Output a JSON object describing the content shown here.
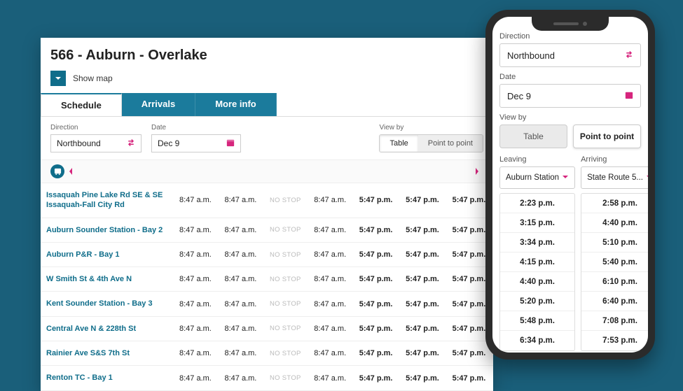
{
  "route": {
    "title": "566 - Auburn - Overlake"
  },
  "showmap": {
    "label": "Show map"
  },
  "tabs": [
    {
      "label": "Schedule",
      "active": true
    },
    {
      "label": "Arrivals",
      "active": false
    },
    {
      "label": "More info",
      "active": false
    }
  ],
  "controls": {
    "direction_label": "Direction",
    "direction_value": "Northbound",
    "date_label": "Date",
    "date_value": "Dec 9",
    "viewby_label": "View by",
    "seg_table": "Table",
    "seg_p2p": "Point to point"
  },
  "schedule": {
    "nostop": "NO STOP",
    "stops": [
      {
        "name": "Issaquah Pine Lake Rd SE & SE Issaquah-Fall City Rd",
        "two_line": true
      },
      {
        "name": "Auburn Sounder Station - Bay 2",
        "two_line": false
      },
      {
        "name": "Auburn P&R - Bay 1",
        "two_line": false
      },
      {
        "name": "W Smith St & 4th Ave N",
        "two_line": false
      },
      {
        "name": "Kent Sounder Station - Bay 3",
        "two_line": false
      },
      {
        "name": "Central Ave N & 228th St",
        "two_line": false
      },
      {
        "name": "Rainier Ave S&S 7th St",
        "two_line": false
      },
      {
        "name": "Renton TC - Bay 1",
        "two_line": false
      }
    ],
    "cols": [
      {
        "v": "8:47 a.m.",
        "bold": false
      },
      {
        "v": "8:47 a.m.",
        "bold": false
      },
      {
        "v": "NO STOP",
        "bold": false
      },
      {
        "v": "8:47 a.m.",
        "bold": false
      },
      {
        "v": "5:47 p.m.",
        "bold": true
      },
      {
        "v": "5:47 p.m.",
        "bold": true
      },
      {
        "v": "5:47 p.m.",
        "bold": true
      }
    ]
  },
  "phone": {
    "direction_label": "Direction",
    "direction_value": "Northbound",
    "date_label": "Date",
    "date_value": "Dec 9",
    "viewby_label": "View by",
    "seg_table": "Table",
    "seg_p2p": "Point to point",
    "leaving_label": "Leaving",
    "arriving_label": "Arriving",
    "leaving_value": "Auburn Station",
    "arriving_value": "State Route 5...",
    "rows": [
      {
        "leave": "2:23 p.m.",
        "arrive": "2:58 p.m."
      },
      {
        "leave": "3:15 p.m.",
        "arrive": "4:40 p.m."
      },
      {
        "leave": "3:34 p.m.",
        "arrive": "5:10 p.m."
      },
      {
        "leave": "4:15 p.m.",
        "arrive": "5:40 p.m."
      },
      {
        "leave": "4:40 p.m.",
        "arrive": "6:10 p.m."
      },
      {
        "leave": "5:20 p.m.",
        "arrive": "6:40 p.m."
      },
      {
        "leave": "5:48 p.m.",
        "arrive": "7:08 p.m."
      },
      {
        "leave": "6:34 p.m.",
        "arrive": "7:53 p.m."
      }
    ]
  }
}
